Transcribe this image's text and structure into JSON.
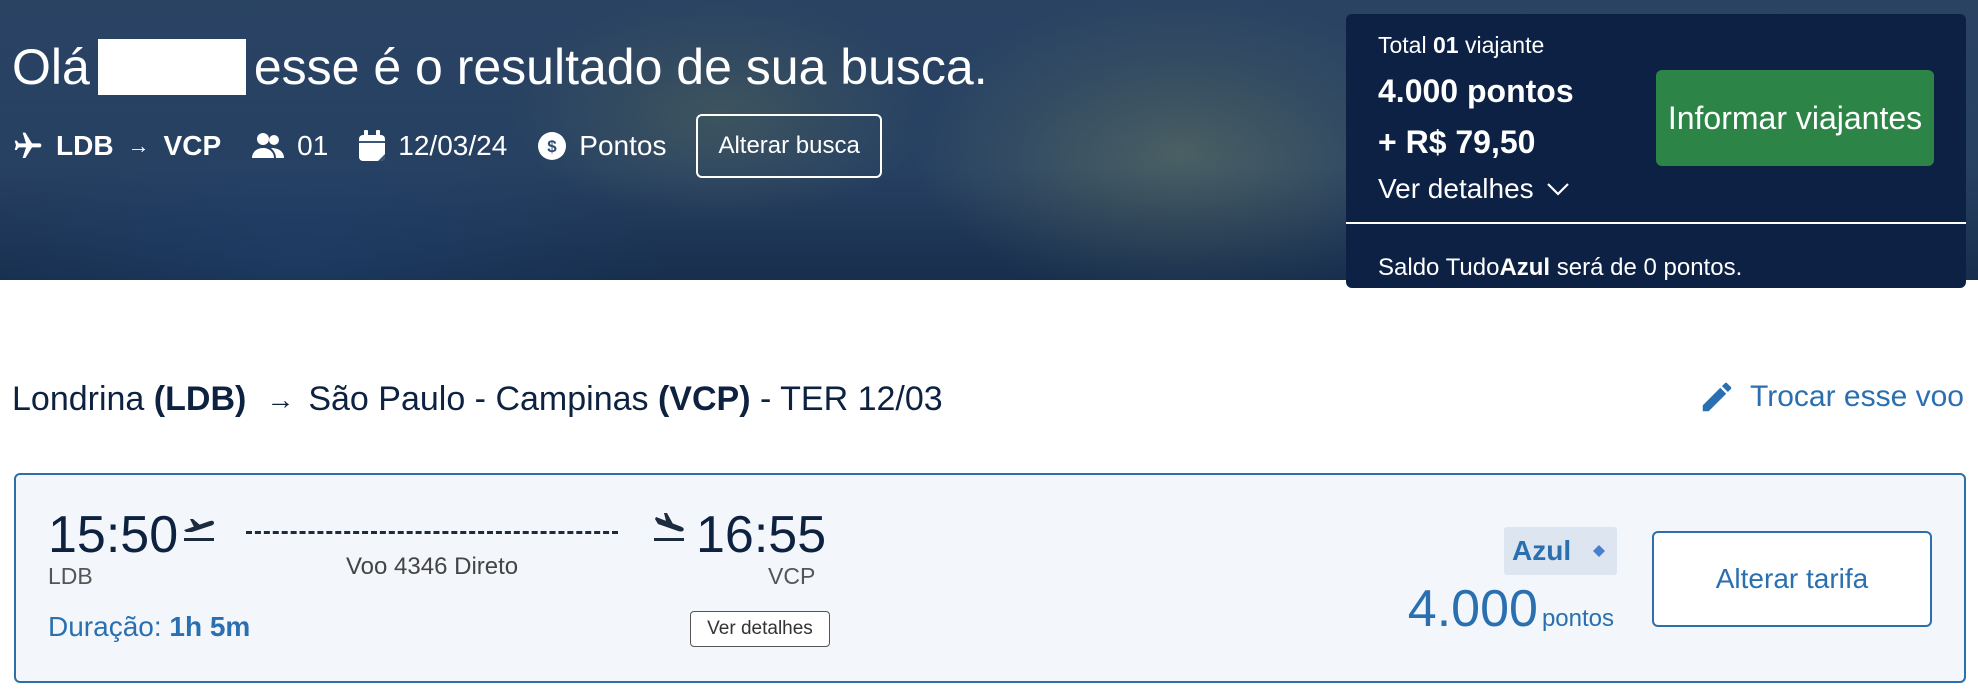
{
  "header": {
    "greeting_prefix": "Olá",
    "greeting_suffix": "esse é o resultado de sua busca.",
    "search": {
      "origin": "LDB",
      "destination": "VCP",
      "passengers": "01",
      "date": "12/03/24",
      "payment": "Pontos",
      "change_button": "Alterar busca"
    }
  },
  "summary": {
    "total_label": "Total",
    "travelers_count": "01",
    "travelers_label": "viajante",
    "points_total": "4.000 pontos",
    "money_total": "+ R$ 79,50",
    "details_link": "Ver detalhes",
    "cta_button": "Informar viajantes",
    "balance_prefix": "Saldo Tudo",
    "balance_brand": "Azul",
    "balance_suffix": "será de 0 pontos."
  },
  "route": {
    "origin_city": "Londrina",
    "origin_code": "(LDB)",
    "destination_city": "São Paulo - Campinas",
    "destination_code": "(VCP)",
    "date_text": "- TER 12/03",
    "change_flight_link": "Trocar esse voo"
  },
  "flight": {
    "departure_time": "15:50",
    "departure_code": "LDB",
    "arrival_time": "16:55",
    "arrival_code": "VCP",
    "flight_info": "Voo 4346 Direto",
    "duration_label": "Duração:",
    "duration_value": "1h 5m",
    "details_button": "Ver detalhes",
    "fare_name": "Azul",
    "fare_points": "4.000",
    "fare_unit": "pontos",
    "change_fare_button": "Alterar tarifa"
  },
  "colors": {
    "navy": "#0c2143",
    "accent_blue": "#2a6fb0",
    "green": "#2d8447"
  }
}
